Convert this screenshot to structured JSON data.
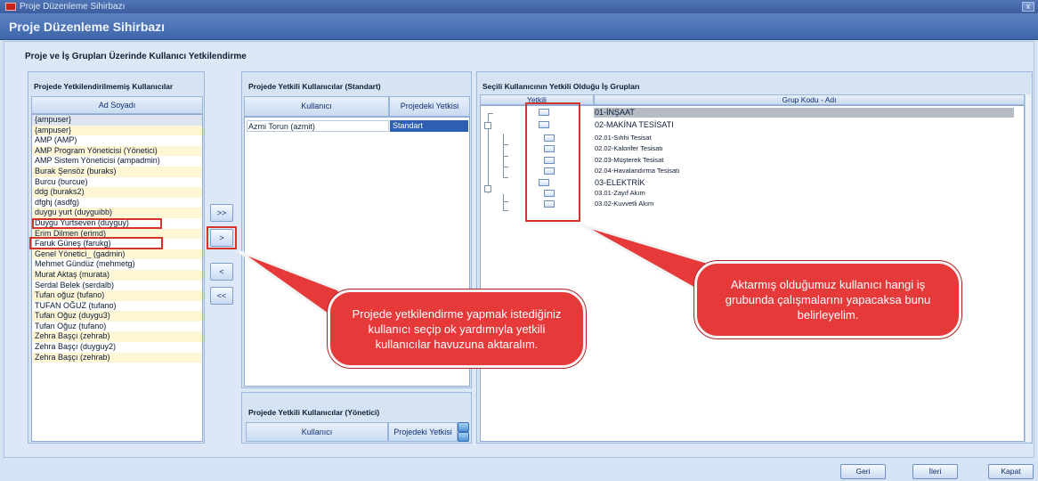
{
  "window": {
    "title": "Proje Düzenleme Sihirbazı",
    "close_glyph": "x"
  },
  "banner": {
    "title": "Proje Düzenleme Sihirbazı"
  },
  "heading": "Proje ve İş Grupları Üzerinde Kullanıcı Yetkilendirme",
  "unauthorized": {
    "title": "Projede Yetkilendirilmemiş Kullanıcılar",
    "column": "Ad Soyadı",
    "users": [
      "{ampuser}",
      "{ampuser}",
      "AMP (AMP)",
      "AMP Program Yöneticisi (Yönetici)",
      "AMP Sistem Yöneticisi (ampadmin)",
      "Burak Şensöz (buraks)",
      "Burcu (burcue)",
      "ddg (buraks2)",
      "dfghj (asdfg)",
      "duygu yurt (duyguibb)",
      "Duygu Yurtseven (duyguy)",
      "Erim Dilmen (erimd)",
      "Faruk Güneş (farukg)",
      "Genel Yönetici_ (gadmin)",
      "Mehmet Gündüz (mehmetg)",
      "Murat Aktaş (murata)",
      "Serdal Belek (serdalb)",
      "Tufan oğuz (tufano)",
      "TUFAN OĞUZ (tufano)",
      "Tufan Oğuz (duygu3)",
      "Tufan Oğuz (tufano)",
      "Zehra Başçı (zehrab)",
      "Zehra Başçı (duyguy2)",
      "Zehra Başçı (zehrab)"
    ]
  },
  "transfer_buttons": {
    "add_all": ">>",
    "add": ">",
    "remove": "<",
    "remove_all": "<<"
  },
  "standard": {
    "title": "Projede Yetkili Kullanıcılar (Standart)",
    "col_user": "Kullanıcı",
    "col_right": "Projedeki Yetkisi",
    "rows": [
      {
        "user": "Azmi Torun (azmit)",
        "right": "Standart"
      }
    ]
  },
  "manager": {
    "title": "Projede Yetkili Kullanıcılar (Yönetici)",
    "col_user": "Kullanıcı",
    "col_right": "Projedeki Yetkisi"
  },
  "groups": {
    "title": "Seçili Kullanıcının Yetkili Olduğu İş Grupları",
    "col_auth": "Yetkili",
    "col_group": "Grup Kodu - Adı",
    "rows": [
      {
        "label": "01-İNŞAAT",
        "small": false
      },
      {
        "label": "02-MAKİNA TESİSATI",
        "small": false
      },
      {
        "label": "02.01-Sıhhi Tesisat",
        "small": true
      },
      {
        "label": "02.02-Kalorifer Tesisatı",
        "small": true
      },
      {
        "label": "02.03-Müşterek Tesisat",
        "small": true
      },
      {
        "label": "02.04-Havalandırma Tesisatı",
        "small": true
      },
      {
        "label": "03-ELEKTRİK",
        "small": false
      },
      {
        "label": "03.01-Zayıf Akım",
        "small": true
      },
      {
        "label": "03.02-Kuvvetli Akım",
        "small": true
      }
    ]
  },
  "callouts": {
    "left": "Projede yetkilendirme yapmak istediğiniz kullanıcı seçip ok yardımıyla yetkili kullanıcılar havuzuna aktaralım.",
    "right": "Aktarmış olduğumuz kullanıcı hangi iş grubunda çalışmalarını yapacaksa bunu belirleyelim."
  },
  "footer": {
    "back": "Geri",
    "next": "İleri",
    "close": "Kapat"
  },
  "colors": {
    "highlight": "#d3352a",
    "callout_fill": "#e6393a",
    "selected_row": "#2f5fb3",
    "banner": "#4a70b4"
  }
}
